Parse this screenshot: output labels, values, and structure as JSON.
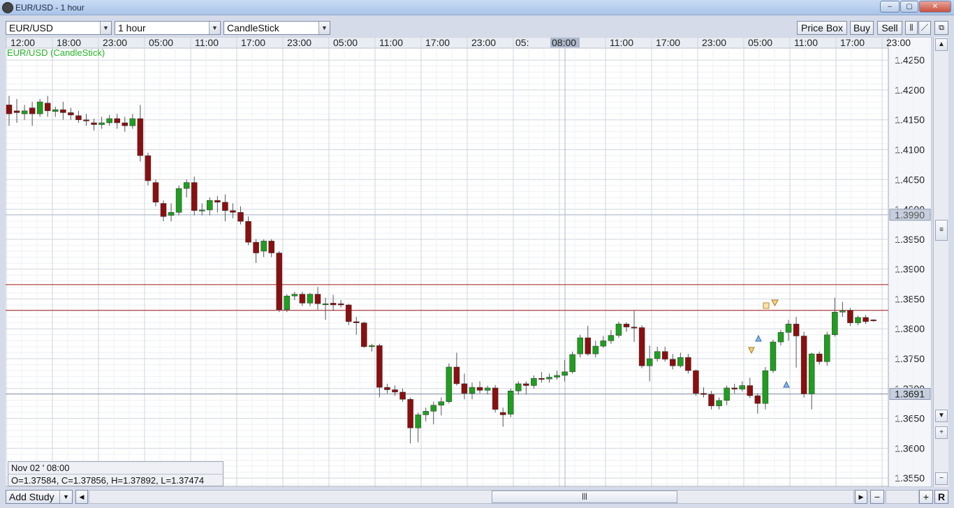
{
  "window": {
    "title": "EUR/USD - 1 hour",
    "buttons": [
      "–",
      "▢",
      "✕"
    ]
  },
  "toolbar": {
    "symbol": "EUR/USD",
    "period": "1 hour",
    "chart_type": "CandleStick",
    "price_box_label": "Price Box",
    "buy_label": "Buy",
    "sell_label": "Sell"
  },
  "chart": {
    "study_label": "EUR/USD (CandleStick)",
    "time_labels": [
      "12:00",
      "18:00",
      "23:00",
      "05:00",
      "11:00",
      "17:00",
      "23:00",
      "05:00",
      "11:00",
      "17:00",
      "23:00",
      "05:",
      "08:00",
      "11:00",
      "17:00",
      "23:00",
      "05:00",
      "11:00",
      "17:00",
      "23:00"
    ],
    "price_labels": [
      "1.4250",
      "1.4200",
      "1.4150",
      "1.4100",
      "1.4050",
      "1.4000",
      "1.3950",
      "1.3900",
      "1.3850",
      "1.3800",
      "1.3750",
      "1.3700",
      "1.3650",
      "1.3600",
      "1.3550"
    ],
    "current_price": "1.3691",
    "crosshair_price_label": "1.3990",
    "crosshair_time": "08:00",
    "horizontal_lines": [
      1.3874,
      1.3831
    ],
    "colors": {
      "bull": "#1f9e1f",
      "bear": "#8b0f0f",
      "grid": "#dfe3ea",
      "hline": "#a01818",
      "study_text": "#25b325"
    }
  },
  "info": {
    "date": "Nov 02 ' 08:00",
    "ohlc": "O=1.37584, C=1.37856, H=1.37892, L=1.37474"
  },
  "bottom": {
    "add_study_label": "Add Study",
    "r_label": "R"
  },
  "chart_data": {
    "type": "candlestick",
    "title": "EUR/USD (CandleStick)",
    "ylim": [
      1.3535,
      1.427
    ],
    "candles": [
      [
        1.4175,
        1.416,
        1.419,
        1.414
      ],
      [
        1.4165,
        1.4162,
        1.4185,
        1.4145
      ],
      [
        1.416,
        1.4165,
        1.4175,
        1.415
      ],
      [
        1.417,
        1.416,
        1.418,
        1.414
      ],
      [
        1.416,
        1.418,
        1.4185,
        1.4155
      ],
      [
        1.4178,
        1.4165,
        1.419,
        1.4155
      ],
      [
        1.4164,
        1.4167,
        1.4172,
        1.4155
      ],
      [
        1.4167,
        1.4162,
        1.418,
        1.415
      ],
      [
        1.4162,
        1.4158,
        1.417,
        1.415
      ],
      [
        1.4157,
        1.415,
        1.4165,
        1.4145
      ],
      [
        1.415,
        1.4148,
        1.416,
        1.414
      ],
      [
        1.4145,
        1.4142,
        1.4152,
        1.4132
      ],
      [
        1.4142,
        1.4145,
        1.4155,
        1.4135
      ],
      [
        1.4145,
        1.4152,
        1.4158,
        1.414
      ],
      [
        1.4152,
        1.4145,
        1.416,
        1.4135
      ],
      [
        1.4145,
        1.414,
        1.4155,
        1.413
      ],
      [
        1.414,
        1.4152,
        1.416,
        1.4135
      ],
      [
        1.4152,
        1.409,
        1.4175,
        1.408
      ],
      [
        1.409,
        1.4048,
        1.4095,
        1.404
      ],
      [
        1.4045,
        1.4012,
        1.405,
        1.4005
      ],
      [
        1.401,
        1.3988,
        1.4015,
        1.398
      ],
      [
        1.399,
        1.3995,
        1.401,
        1.398
      ],
      [
        1.3995,
        1.4035,
        1.404,
        1.399
      ],
      [
        1.4035,
        1.4045,
        1.405,
        1.402
      ],
      [
        1.4045,
        1.3998,
        1.4055,
        1.399
      ],
      [
        1.3998,
        1.3999,
        1.401,
        1.399
      ],
      [
        1.3999,
        1.4015,
        1.402,
        1.399
      ],
      [
        1.4015,
        1.4012,
        1.4022,
        1.3995
      ],
      [
        1.4012,
        1.3998,
        1.4025,
        1.398
      ],
      [
        1.3998,
        1.3995,
        1.401,
        1.3985
      ],
      [
        1.3995,
        1.398,
        1.4005,
        1.3975
      ],
      [
        1.398,
        1.3945,
        1.3988,
        1.394
      ],
      [
        1.3945,
        1.3927,
        1.395,
        1.391
      ],
      [
        1.393,
        1.3947,
        1.395,
        1.392
      ],
      [
        1.3947,
        1.3927,
        1.395,
        1.392
      ],
      [
        1.3927,
        1.3832,
        1.393,
        1.3828
      ],
      [
        1.3832,
        1.3855,
        1.3858,
        1.3828
      ],
      [
        1.3855,
        1.3858,
        1.3862,
        1.3848
      ],
      [
        1.3858,
        1.3843,
        1.3862,
        1.3838
      ],
      [
        1.3843,
        1.3858,
        1.386,
        1.3838
      ],
      [
        1.3858,
        1.3842,
        1.387,
        1.3832
      ],
      [
        1.3842,
        1.3842,
        1.3852,
        1.3815
      ],
      [
        1.3843,
        1.384,
        1.3857,
        1.383
      ],
      [
        1.3842,
        1.384,
        1.3848,
        1.3836
      ],
      [
        1.384,
        1.3812,
        1.3842,
        1.3806
      ],
      [
        1.3812,
        1.381,
        1.382,
        1.379
      ],
      [
        1.381,
        1.377,
        1.3812,
        1.3768
      ],
      [
        1.377,
        1.3772,
        1.3775,
        1.3762
      ],
      [
        1.3772,
        1.3702,
        1.3775,
        1.3685
      ],
      [
        1.3702,
        1.3698,
        1.3708,
        1.3692
      ],
      [
        1.3698,
        1.3694,
        1.3705,
        1.3688
      ],
      [
        1.3694,
        1.3682,
        1.37,
        1.3678
      ],
      [
        1.3682,
        1.3634,
        1.3685,
        1.3608
      ],
      [
        1.3634,
        1.3656,
        1.366,
        1.361
      ],
      [
        1.3656,
        1.3662,
        1.3668,
        1.3645
      ],
      [
        1.3662,
        1.3672,
        1.3678,
        1.364
      ],
      [
        1.3672,
        1.3678,
        1.3685,
        1.3655
      ],
      [
        1.3678,
        1.3736,
        1.3742,
        1.3675
      ],
      [
        1.3736,
        1.3708,
        1.376,
        1.3705
      ],
      [
        1.3708,
        1.3692,
        1.3725,
        1.3682
      ],
      [
        1.3692,
        1.3702,
        1.371,
        1.3682
      ],
      [
        1.3702,
        1.3697,
        1.3712,
        1.3692
      ],
      [
        1.3697,
        1.3701,
        1.3705,
        1.369
      ],
      [
        1.3701,
        1.3665,
        1.3706,
        1.366
      ],
      [
        1.366,
        1.3656,
        1.3668,
        1.3636
      ],
      [
        1.3657,
        1.3696,
        1.37,
        1.3652
      ],
      [
        1.3696,
        1.3708,
        1.3712,
        1.369
      ],
      [
        1.3708,
        1.3705,
        1.3712,
        1.369
      ],
      [
        1.3705,
        1.3717,
        1.3722,
        1.37
      ],
      [
        1.3717,
        1.3716,
        1.3728,
        1.371
      ],
      [
        1.3716,
        1.3719,
        1.3725,
        1.371
      ],
      [
        1.3719,
        1.3722,
        1.373,
        1.3715
      ],
      [
        1.3722,
        1.3728,
        1.3748,
        1.3712
      ],
      [
        1.3728,
        1.3757,
        1.3762,
        1.3725
      ],
      [
        1.3758,
        1.3785,
        1.379,
        1.3752
      ],
      [
        1.3785,
        1.3758,
        1.3805,
        1.3755
      ],
      [
        1.3758,
        1.3771,
        1.378,
        1.3752
      ],
      [
        1.3771,
        1.378,
        1.3788,
        1.3768
      ],
      [
        1.378,
        1.3789,
        1.3798,
        1.3775
      ],
      [
        1.3789,
        1.3808,
        1.3812,
        1.3785
      ],
      [
        1.3808,
        1.3803,
        1.3811,
        1.3795
      ],
      [
        1.3803,
        1.3802,
        1.383,
        1.3778
      ],
      [
        1.3802,
        1.3738,
        1.3806,
        1.3734
      ],
      [
        1.3738,
        1.375,
        1.3772,
        1.3712
      ],
      [
        1.375,
        1.3762,
        1.377,
        1.3745
      ],
      [
        1.3762,
        1.3749,
        1.377,
        1.3745
      ],
      [
        1.3749,
        1.3738,
        1.3758,
        1.3732
      ],
      [
        1.3738,
        1.3752,
        1.376,
        1.3735
      ],
      [
        1.3752,
        1.373,
        1.3758,
        1.3725
      ],
      [
        1.373,
        1.3692,
        1.3732,
        1.3688
      ],
      [
        1.3692,
        1.369,
        1.3702,
        1.3685
      ],
      [
        1.369,
        1.3671,
        1.3696,
        1.3665
      ],
      [
        1.3671,
        1.368,
        1.3685,
        1.3665
      ],
      [
        1.368,
        1.3701,
        1.3705,
        1.3672
      ],
      [
        1.3701,
        1.3699,
        1.3708,
        1.3692
      ],
      [
        1.3699,
        1.3705,
        1.3712,
        1.3695
      ],
      [
        1.3705,
        1.3688,
        1.3718,
        1.3684
      ],
      [
        1.3688,
        1.3675,
        1.3692,
        1.3658
      ],
      [
        1.3675,
        1.373,
        1.3736,
        1.3665
      ],
      [
        1.373,
        1.3778,
        1.3782,
        1.3726
      ],
      [
        1.3778,
        1.3794,
        1.3798,
        1.3772
      ],
      [
        1.3794,
        1.3808,
        1.3815,
        1.378
      ],
      [
        1.3808,
        1.3788,
        1.382,
        1.3735
      ],
      [
        1.3788,
        1.3691,
        1.3795,
        1.3685
      ],
      [
        1.3691,
        1.3758,
        1.376,
        1.3665
      ],
      [
        1.3758,
        1.3745,
        1.3762,
        1.374
      ],
      [
        1.3745,
        1.379,
        1.3795,
        1.3738
      ],
      [
        1.379,
        1.3828,
        1.3852,
        1.3787
      ],
      [
        1.3828,
        1.383,
        1.3845,
        1.382
      ],
      [
        1.3831,
        1.381,
        1.3835,
        1.3805
      ],
      [
        1.381,
        1.3819,
        1.3822,
        1.3806
      ],
      [
        1.3819,
        1.3812,
        1.3823,
        1.3808
      ],
      [
        1.3815,
        1.3814,
        1.3816,
        1.3812
      ]
    ]
  }
}
